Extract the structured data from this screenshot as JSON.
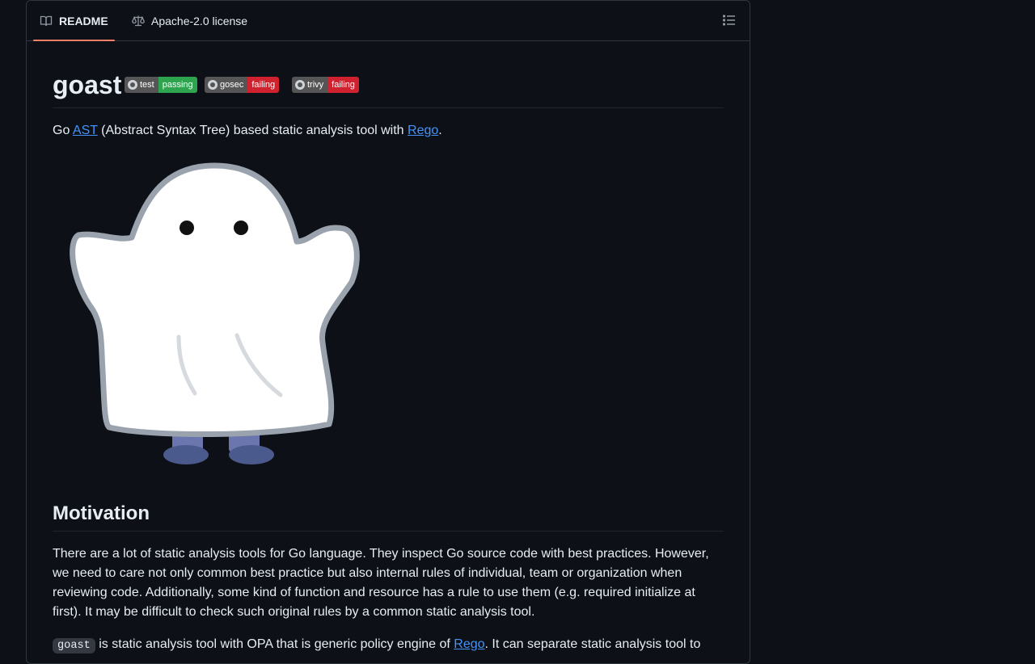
{
  "tabs": {
    "readme": "README",
    "license": "Apache-2.0 license"
  },
  "readme": {
    "title": "goast",
    "badges": [
      {
        "label": "test",
        "status": "passing",
        "color": "#2ea44f"
      },
      {
        "label": "gosec",
        "status": "failing",
        "color": "#cf222e"
      },
      {
        "label": "trivy",
        "status": "failing",
        "color": "#cf222e"
      }
    ],
    "intro": {
      "pre": "Go ",
      "link1": "AST",
      "mid": " (Abstract Syntax Tree) based static analysis tool with ",
      "link2": "Rego",
      "post": "."
    },
    "motivation_heading": "Motivation",
    "motivation_para": "There are a lot of static analysis tools for Go language. They inspect Go source code with best practices. However, we need to care not only common best practice but also internal rules of individual, team or organization when reviewing code. Additionally, some kind of function and resource has a rule to use them (e.g. required initialize at first). It may be difficult to check such original rules by a common static analysis tool.",
    "para2": {
      "code": "goast",
      "pre": " is static analysis tool with OPA that is generic policy engine of ",
      "link": "Rego",
      "post": ". It can separate static analysis tool to"
    }
  },
  "colors": {
    "background": "#0d1117",
    "border": "#30363d",
    "link": "#4493f8",
    "tab_underline": "#f78166"
  },
  "icons": [
    "book-icon",
    "law-icon",
    "list-unordered-icon",
    "github-mark-icon"
  ]
}
